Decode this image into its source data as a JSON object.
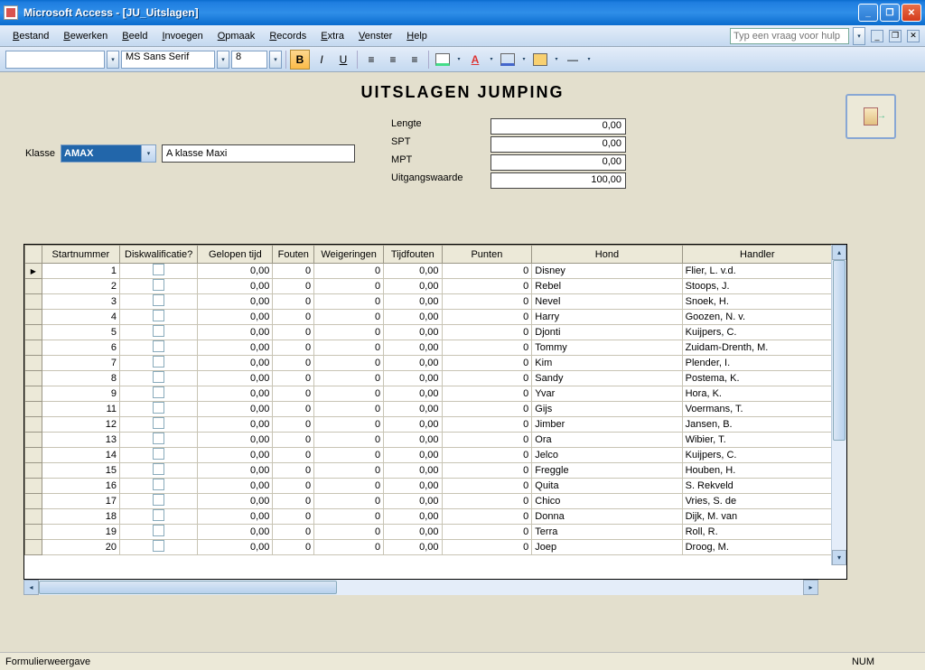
{
  "title": "Microsoft Access - [JU_Uitslagen]",
  "menus": [
    "Bestand",
    "Bewerken",
    "Beeld",
    "Invoegen",
    "Opmaak",
    "Records",
    "Extra",
    "Venster",
    "Help"
  ],
  "help_placeholder": "Typ een vraag voor hulp",
  "toolbar": {
    "font": "MS Sans Serif",
    "size": "8"
  },
  "form": {
    "title": "UITSLAGEN JUMPING",
    "klasse_label": "Klasse",
    "klasse_value": "AMAX",
    "klasse_desc": "A klasse Maxi",
    "fields": {
      "lengte_label": "Lengte",
      "lengte_value": "0,00",
      "spt_label": "SPT",
      "spt_value": "0,00",
      "mpt_label": "MPT",
      "mpt_value": "0,00",
      "uitgang_label": "Uitgangswaarde",
      "uitgang_value": "100,00"
    }
  },
  "columns": [
    "Startnummer",
    "Diskwalificatie?",
    "Gelopen tijd",
    "Fouten",
    "Weigeringen",
    "Tijdfouten",
    "Punten",
    "Hond",
    "Handler"
  ],
  "rows": [
    {
      "start": "1",
      "tijd": "0,00",
      "fout": "0",
      "weig": "0",
      "tfout": "0,00",
      "punten": "0",
      "hond": "Disney",
      "handler": "Flier, L. v.d."
    },
    {
      "start": "2",
      "tijd": "0,00",
      "fout": "0",
      "weig": "0",
      "tfout": "0,00",
      "punten": "0",
      "hond": "Rebel",
      "handler": "Stoops, J."
    },
    {
      "start": "3",
      "tijd": "0,00",
      "fout": "0",
      "weig": "0",
      "tfout": "0,00",
      "punten": "0",
      "hond": "Nevel",
      "handler": "Snoek, H."
    },
    {
      "start": "4",
      "tijd": "0,00",
      "fout": "0",
      "weig": "0",
      "tfout": "0,00",
      "punten": "0",
      "hond": "Harry",
      "handler": "Goozen, N. v."
    },
    {
      "start": "5",
      "tijd": "0,00",
      "fout": "0",
      "weig": "0",
      "tfout": "0,00",
      "punten": "0",
      "hond": "Djonti",
      "handler": "Kuijpers, C."
    },
    {
      "start": "6",
      "tijd": "0,00",
      "fout": "0",
      "weig": "0",
      "tfout": "0,00",
      "punten": "0",
      "hond": "Tommy",
      "handler": "Zuidam-Drenth, M."
    },
    {
      "start": "7",
      "tijd": "0,00",
      "fout": "0",
      "weig": "0",
      "tfout": "0,00",
      "punten": "0",
      "hond": "Kim",
      "handler": "Plender, I."
    },
    {
      "start": "8",
      "tijd": "0,00",
      "fout": "0",
      "weig": "0",
      "tfout": "0,00",
      "punten": "0",
      "hond": "Sandy",
      "handler": "Postema, K."
    },
    {
      "start": "9",
      "tijd": "0,00",
      "fout": "0",
      "weig": "0",
      "tfout": "0,00",
      "punten": "0",
      "hond": "Yvar",
      "handler": "Hora, K."
    },
    {
      "start": "11",
      "tijd": "0,00",
      "fout": "0",
      "weig": "0",
      "tfout": "0,00",
      "punten": "0",
      "hond": "Gijs",
      "handler": "Voermans, T."
    },
    {
      "start": "12",
      "tijd": "0,00",
      "fout": "0",
      "weig": "0",
      "tfout": "0,00",
      "punten": "0",
      "hond": "Jimber",
      "handler": "Jansen, B."
    },
    {
      "start": "13",
      "tijd": "0,00",
      "fout": "0",
      "weig": "0",
      "tfout": "0,00",
      "punten": "0",
      "hond": "Ora",
      "handler": "Wibier, T."
    },
    {
      "start": "14",
      "tijd": "0,00",
      "fout": "0",
      "weig": "0",
      "tfout": "0,00",
      "punten": "0",
      "hond": "Jelco",
      "handler": "Kuijpers, C."
    },
    {
      "start": "15",
      "tijd": "0,00",
      "fout": "0",
      "weig": "0",
      "tfout": "0,00",
      "punten": "0",
      "hond": "Freggle",
      "handler": "Houben, H."
    },
    {
      "start": "16",
      "tijd": "0,00",
      "fout": "0",
      "weig": "0",
      "tfout": "0,00",
      "punten": "0",
      "hond": "Quita",
      "handler": "S. Rekveld"
    },
    {
      "start": "17",
      "tijd": "0,00",
      "fout": "0",
      "weig": "0",
      "tfout": "0,00",
      "punten": "0",
      "hond": "Chico",
      "handler": "Vries, S. de"
    },
    {
      "start": "18",
      "tijd": "0,00",
      "fout": "0",
      "weig": "0",
      "tfout": "0,00",
      "punten": "0",
      "hond": "Donna",
      "handler": "Dijk, M. van"
    },
    {
      "start": "19",
      "tijd": "0,00",
      "fout": "0",
      "weig": "0",
      "tfout": "0,00",
      "punten": "0",
      "hond": "Terra",
      "handler": "Roll, R."
    },
    {
      "start": "20",
      "tijd": "0,00",
      "fout": "0",
      "weig": "0",
      "tfout": "0,00",
      "punten": "0",
      "hond": "Joep",
      "handler": "Droog, M."
    }
  ],
  "statusbar": {
    "left": "Formulierweergave",
    "right": "NUM"
  }
}
